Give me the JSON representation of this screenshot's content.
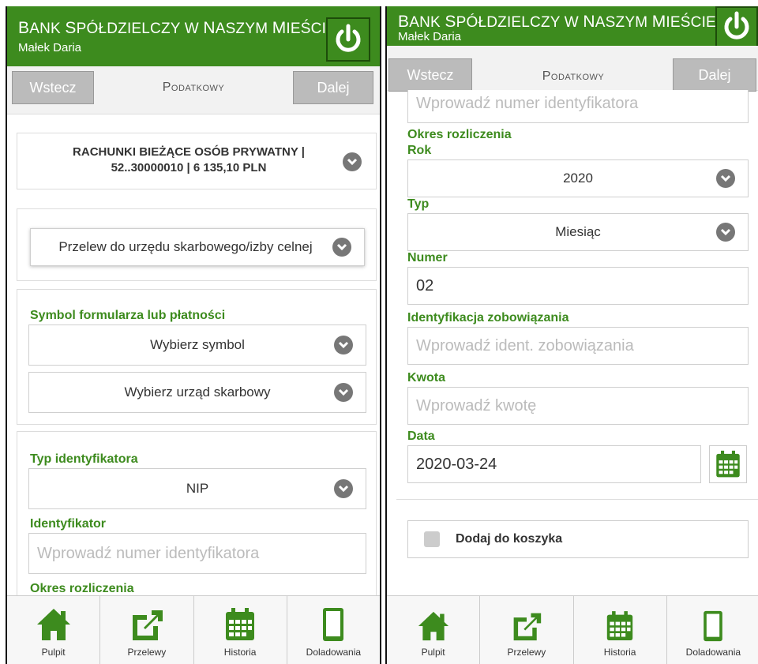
{
  "app": {
    "bank_name": "Bank Spółdzielczy w Naszym Mieście",
    "bank_name_b": "B",
    "bank_name_rest1": "ANK ",
    "bank_name_s": "S",
    "bank_name_rest2": "PÓŁDZIELCZY W ",
    "bank_name_n": "N",
    "bank_name_rest3": "ASZYM ",
    "bank_name_m": "M",
    "bank_name_rest4": "IEŚCIE",
    "user_name": "Małek Daria"
  },
  "nav": {
    "back_label": "Wstecz",
    "title": "Podatkowy",
    "next_label": "Dalej"
  },
  "screen1": {
    "account": "RACHUNKI BIEŻĄCE OSÓB PRYWATNY | 52..30000010 | 6 135,10 PLN",
    "transfer_type": "Przelew do urzędu skarbowego/izby celnej",
    "symbol_label": "Symbol formularza lub płatności",
    "symbol_value": "Wybierz symbol",
    "office_value": "Wybierz urząd skarbowy",
    "id_type_label": "Typ identyfikatora",
    "id_type_value": "NIP",
    "id_label": "Identyfikator",
    "id_placeholder": "Wprowadź numer identyfikatora",
    "period_label": "Okres rozliczenia"
  },
  "screen2": {
    "id_placeholder": "Wprowadź numer identyfikatora",
    "period_label": "Okres rozliczenia",
    "year_label": "Rok",
    "year_value": "2020",
    "type_label": "Typ",
    "type_value": "Miesiąc",
    "number_label": "Numer",
    "number_value": "02",
    "obligation_label": "Identyfikacja zobowiązania",
    "obligation_placeholder": "Wprowadź ident. zobowiązania",
    "amount_label": "Kwota",
    "amount_placeholder": "Wprowadź kwotę",
    "date_label": "Data",
    "date_value": "2020-03-24",
    "basket_label": "Dodaj do koszyka"
  },
  "footer": {
    "tabs": [
      {
        "label": "Pulpit",
        "icon": "home-icon"
      },
      {
        "label": "Przelewy",
        "icon": "transfer-icon"
      },
      {
        "label": "Historia",
        "icon": "calendar-icon"
      },
      {
        "label": "Doladowania",
        "icon": "phone-icon"
      }
    ]
  },
  "colors": {
    "brand_green": "#3d8b1e",
    "nav_button": "#bbbbbb"
  }
}
